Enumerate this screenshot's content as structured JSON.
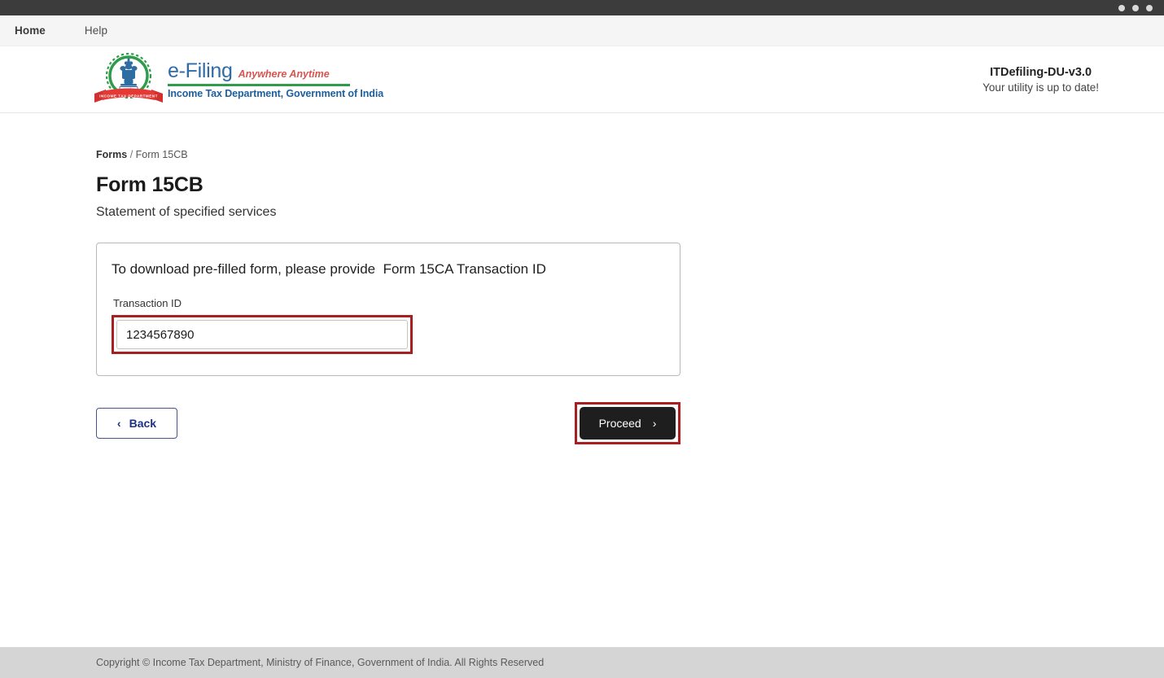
{
  "window": {
    "dots": [
      "dot-1",
      "dot-2",
      "dot-3"
    ]
  },
  "nav": {
    "items": [
      {
        "label": "Home",
        "active": true
      },
      {
        "label": "Help",
        "active": false
      }
    ]
  },
  "brand": {
    "emblem_name": "india-state-emblem-income-tax-logo",
    "title": "e-Filing",
    "tagline": "Anywhere Anytime",
    "department": "Income Tax Department, Government of India",
    "colors": {
      "title_blue": "#2f6ca5",
      "tagline_red": "#d9534f",
      "rule_green": "#2e9c4a",
      "department_blue": "#1d5f9e"
    }
  },
  "version": {
    "name": "ITDefiling-DU-v3.0",
    "status": "Your utility is up to date!"
  },
  "breadcrumb": {
    "root": "Forms",
    "separator": "/",
    "current": "Form 15CB"
  },
  "page": {
    "title": "Form 15CB",
    "subtitle": "Statement of specified services"
  },
  "card": {
    "heading": "To download pre-filled form, please provide  Form 15CA Transaction ID",
    "field_label": "Transaction ID",
    "input_value": "1234567890",
    "input_placeholder": "",
    "highlight_color": "#a81f21"
  },
  "buttons": {
    "back": {
      "label": "Back",
      "chevron": "‹"
    },
    "proceed": {
      "label": "Proceed",
      "chevron": "›",
      "highlight_color": "#a81f21"
    }
  },
  "footer": {
    "text": "Copyright © Income Tax Department, Ministry of Finance, Government of India. All Rights Reserved"
  }
}
